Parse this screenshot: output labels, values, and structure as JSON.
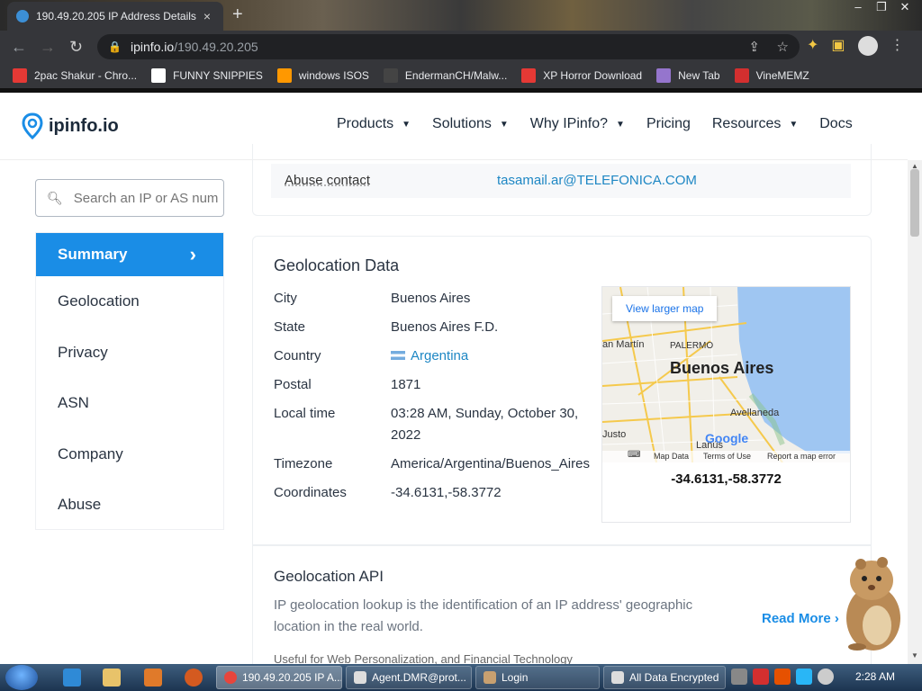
{
  "browser": {
    "tab_title": "190.49.20.205 IP Address Details",
    "tab_close": "×",
    "new_tab": "+",
    "url_host": "ipinfo.io",
    "url_path": "/190.49.20.205",
    "window_controls": [
      "–",
      "❐",
      "✕"
    ],
    "bookmarks": [
      {
        "label": "2pac Shakur - Chro...",
        "icon": "music-icon",
        "color": "#e53935"
      },
      {
        "label": "FUNNY SNIPPIES",
        "icon": "h-logo-icon",
        "color": "#ffffff"
      },
      {
        "label": "windows ISOS",
        "icon": "ph-logo-icon",
        "color": "#ff9800"
      },
      {
        "label": "EndermanCH/Malw...",
        "icon": "yp-logo-icon",
        "color": "#444444"
      },
      {
        "label": "XP Horror Download",
        "icon": "x-logo-icon",
        "color": "#e53935"
      },
      {
        "label": "New Tab",
        "icon": "globe-icon",
        "color": "#9575cd"
      },
      {
        "label": "VineMEMZ",
        "icon": "r-logo-icon",
        "color": "#d32f2f"
      }
    ]
  },
  "site": {
    "logo_text": "ipinfo.io",
    "nav": [
      {
        "label": "Products",
        "dropdown": true
      },
      {
        "label": "Solutions",
        "dropdown": true
      },
      {
        "label": "Why IPinfo?",
        "dropdown": true
      },
      {
        "label": "Pricing",
        "dropdown": false
      },
      {
        "label": "Resources",
        "dropdown": true
      },
      {
        "label": "Docs",
        "dropdown": false
      }
    ],
    "accent": "#1a8de6"
  },
  "sidebar": {
    "search_placeholder": "Search an IP or AS number",
    "items": [
      "Summary",
      "Geolocation",
      "Privacy",
      "ASN",
      "Company",
      "Abuse"
    ],
    "active": "Summary"
  },
  "abuse": {
    "label": "Abuse contact",
    "value": "tasamail.ar@TELEFONICA.COM"
  },
  "geolocation": {
    "title": "Geolocation Data",
    "rows": [
      {
        "key": "City",
        "value": "Buenos Aires"
      },
      {
        "key": "State",
        "value": "Buenos Aires F.D."
      },
      {
        "key": "Country",
        "value": "Argentina"
      },
      {
        "key": "Postal",
        "value": "1871"
      },
      {
        "key": "Local time",
        "value": "03:28 AM, Sunday, October 30, 2022"
      },
      {
        "key": "Timezone",
        "value": "America/Argentina/Buenos_Aires"
      },
      {
        "key": "Coordinates",
        "value": "-34.6131,-58.3772"
      }
    ],
    "map": {
      "button": "View larger map",
      "city_label": "Buenos Aires",
      "places": [
        "an Martín",
        "PALERMO",
        "Avellaneda",
        "Justo",
        "Lanús"
      ],
      "google": "Google",
      "footer": [
        "Map Data",
        "Terms of Use",
        "Report a map error"
      ],
      "caption": "-34.6131,-58.3772"
    }
  },
  "geo_api": {
    "title": "Geolocation API",
    "description": "IP geolocation lookup is the identification of an IP address' geographic location in the real world.",
    "read_more": "Read More",
    "useful": "Useful for Web Personalization, and Financial Technology"
  },
  "taskbar": {
    "buttons": [
      "190.49.20.205 IP A...",
      "Agent.DMR@prot...",
      "Login",
      "All Data Encrypted"
    ],
    "clock": "2:28 AM"
  }
}
